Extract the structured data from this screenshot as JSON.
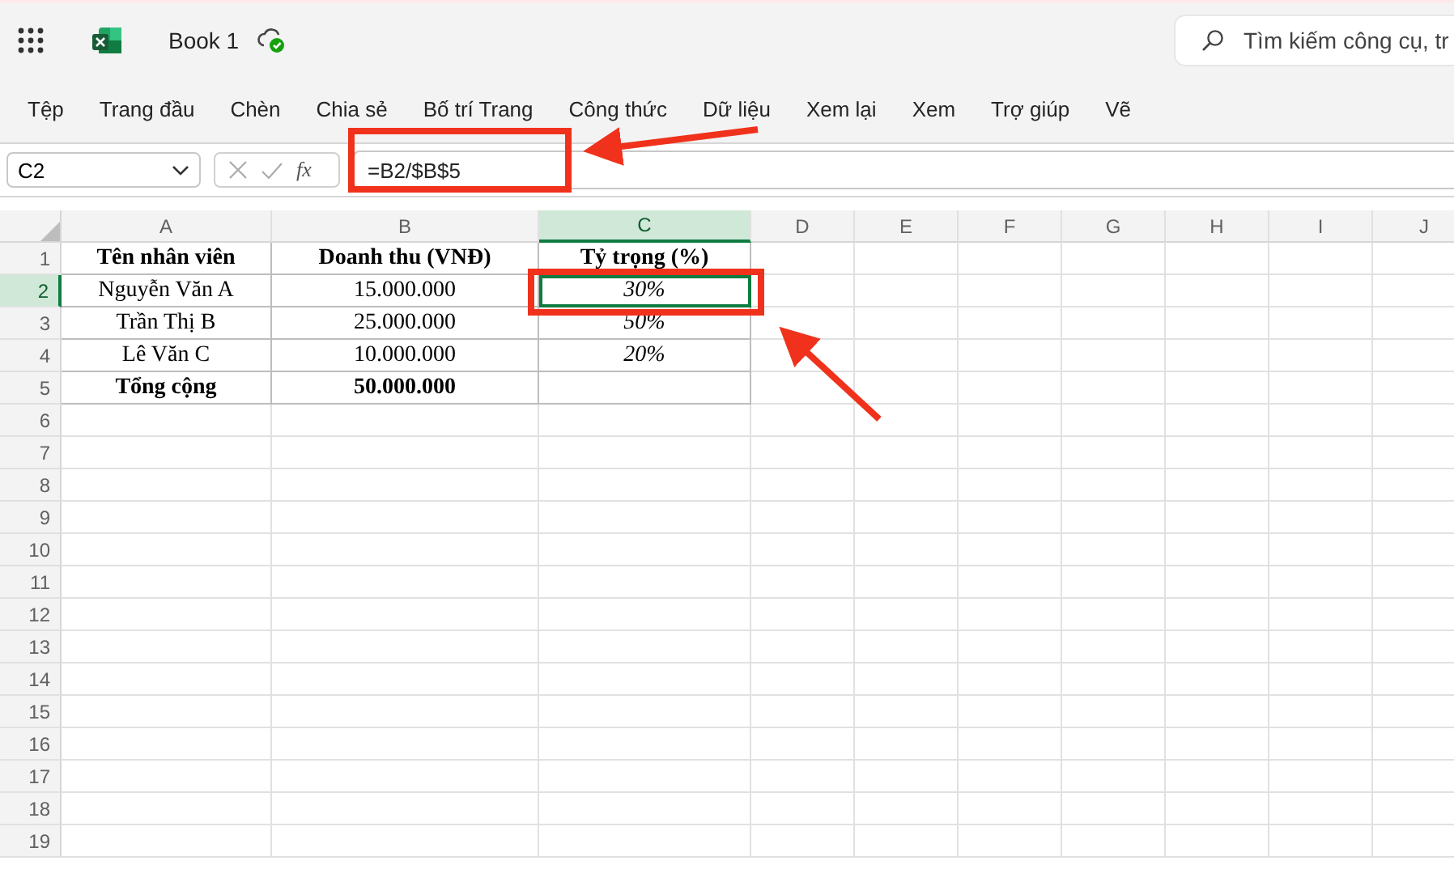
{
  "app_bar": {
    "title": "Book 1",
    "search": {
      "placeholder": "Tìm kiếm công cụ, tr"
    }
  },
  "ribbon_tabs": [
    {
      "label": "Tệp",
      "selected": false
    },
    {
      "label": "Trang đầu",
      "selected": false
    },
    {
      "label": "Chèn",
      "selected": false
    },
    {
      "label": "Chia sẻ",
      "selected": false
    },
    {
      "label": "Bố trí Trang",
      "selected": false
    },
    {
      "label": "Công thức",
      "selected": false
    },
    {
      "label": "Dữ liệu",
      "selected": false
    },
    {
      "label": "Xem lại",
      "selected": false
    },
    {
      "label": "Xem",
      "selected": false
    },
    {
      "label": "Trợ giúp",
      "selected": false
    },
    {
      "label": "Vẽ",
      "selected": false
    }
  ],
  "formula_bar": {
    "name_box": "C2",
    "fx": "fx",
    "formula": "=B2/$B$5"
  },
  "sheet": {
    "columns": [
      {
        "label": "A",
        "selected": false
      },
      {
        "label": "B",
        "selected": false
      },
      {
        "label": "C",
        "selected": true,
        "italic": true
      },
      {
        "label": "D",
        "selected": false
      },
      {
        "label": "E",
        "selected": false
      },
      {
        "label": "F",
        "selected": false
      },
      {
        "label": "G",
        "selected": false
      },
      {
        "label": "H",
        "selected": false
      },
      {
        "label": "I",
        "selected": false
      },
      {
        "label": "J",
        "selected": false
      }
    ],
    "rows": [
      {
        "number": "1",
        "selected": false,
        "kind": "header",
        "cells": [
          "Tên nhân viên",
          "Doanh thu (VNĐ)",
          "Tỷ trọng (%)"
        ]
      },
      {
        "number": "2",
        "selected": true,
        "kind": "data",
        "cells": [
          "Nguyễn Văn A",
          "15.000.000",
          "30%"
        ]
      },
      {
        "number": "3",
        "selected": false,
        "kind": "data",
        "cells": [
          "Trần Thị B",
          "25.000.000",
          "50%"
        ]
      },
      {
        "number": "4",
        "selected": false,
        "kind": "data",
        "cells": [
          "Lê Văn C",
          "10.000.000",
          "20%"
        ]
      },
      {
        "number": "5",
        "selected": false,
        "kind": "total",
        "cells": [
          "Tổng cộng",
          "50.000.000"
        ]
      },
      {
        "number": "6",
        "selected": false,
        "kind": "empty",
        "cells": []
      },
      {
        "number": "7",
        "selected": false,
        "kind": "empty",
        "cells": []
      },
      {
        "number": "8",
        "selected": false,
        "kind": "empty",
        "cells": []
      },
      {
        "number": "9",
        "selected": false,
        "kind": "empty",
        "cells": []
      },
      {
        "number": "10",
        "selected": false,
        "kind": "empty",
        "cells": []
      },
      {
        "number": "11",
        "selected": false,
        "kind": "empty",
        "cells": []
      },
      {
        "number": "12",
        "selected": false,
        "kind": "empty",
        "cells": []
      },
      {
        "number": "13",
        "selected": false,
        "kind": "empty",
        "cells": []
      },
      {
        "number": "14",
        "selected": false,
        "kind": "empty",
        "cells": []
      },
      {
        "number": "15",
        "selected": false,
        "kind": "empty",
        "cells": []
      },
      {
        "number": "16",
        "selected": false,
        "kind": "empty",
        "cells": []
      },
      {
        "number": "17",
        "selected": false,
        "kind": "empty",
        "cells": []
      },
      {
        "number": "18",
        "selected": false,
        "kind": "empty",
        "cells": []
      },
      {
        "number": "19",
        "selected": false,
        "kind": "empty",
        "cells": []
      }
    ]
  }
}
